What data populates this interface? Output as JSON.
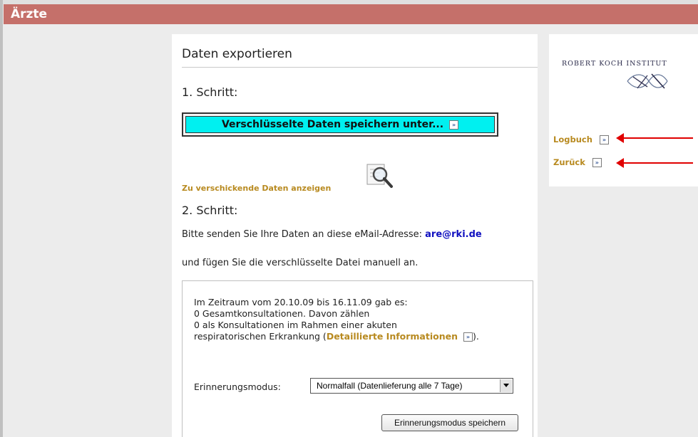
{
  "title": "Ärzte",
  "main": {
    "heading": "Daten exportieren",
    "step1": "1. Schritt:",
    "export_button": "Verschlüsselte Daten speichern unter...",
    "show_data_link": "Zu verschickende Daten anzeigen",
    "step2": "2. Schritt:",
    "send_text": "Bitte senden Sie Ihre Daten an diese eMail-Adresse:",
    "email": "are@rki.de",
    "attach_text": "und fügen Sie die verschlüsselte Datei manuell an.",
    "info": {
      "line1": "Im Zeitraum vom 20.10.09 bis 16.11.09 gab es:",
      "line2": "0 Gesamtkonsultationen. Davon zählen",
      "line3": "0 als Konsultationen im Rahmen einer akuten",
      "line4_prefix": "respiratorischen Erkrankung (",
      "detail_link": "Detaillierte Informationen",
      "line4_suffix": ")."
    },
    "reminder_label": "Erinnerungsmodus:",
    "reminder_value": "Normalfall (Datenlieferung alle 7 Tage)",
    "save_reminder_button": "Erinnerungsmodus speichern"
  },
  "sidebar": {
    "logo_text": "ROBERT KOCH INSTITUT",
    "logbook_link": "Logbuch",
    "back_link": "Zurück"
  },
  "icons": {
    "chevron": "double-chevron-right-icon",
    "magnifier": "magnifier-icon"
  },
  "colors": {
    "titlebar": "#c5706a",
    "export_button": "#00f0f0",
    "link": "#b88a20",
    "email": "#1010c0",
    "annotation_arrow": "#e00000"
  }
}
